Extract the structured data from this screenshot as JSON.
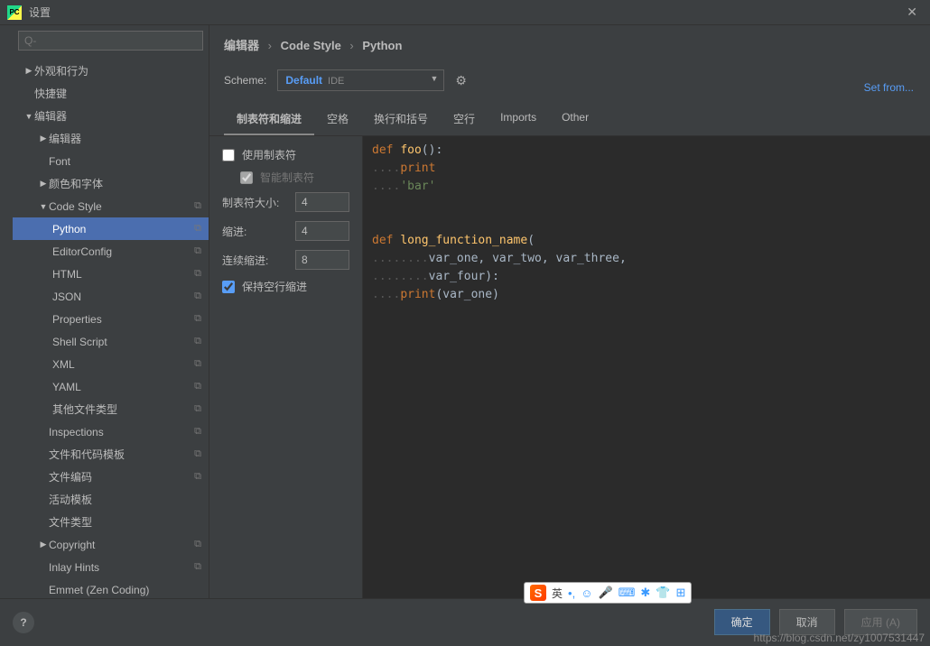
{
  "title": "设置",
  "search_placeholder": "Q-",
  "tree": {
    "appearance": "外观和行为",
    "keymap": "快捷键",
    "editor": "编辑器",
    "editor_sub": "编辑器",
    "font": "Font",
    "colors": "颜色和字体",
    "codestyle": "Code Style",
    "python": "Python",
    "editorconfig": "EditorConfig",
    "html": "HTML",
    "json": "JSON",
    "properties": "Properties",
    "shell": "Shell Script",
    "xml": "XML",
    "yaml": "YAML",
    "otherft": "其他文件类型",
    "inspections": "Inspections",
    "templates": "文件和代码模板",
    "encoding": "文件编码",
    "livetemplates": "活动模板",
    "filetypes": "文件类型",
    "copyright": "Copyright",
    "inlay": "Inlay Hints",
    "emmet": "Emmet (Zen Coding)"
  },
  "crumbs": {
    "a": "编辑器",
    "b": "Code Style",
    "c": "Python"
  },
  "scheme": {
    "label": "Scheme:",
    "value": "Default",
    "ide": "IDE"
  },
  "setfrom": "Set from...",
  "tabs": {
    "t1": "制表符和缩进",
    "t2": "空格",
    "t3": "换行和括号",
    "t4": "空行",
    "t5": "Imports",
    "t6": "Other"
  },
  "opts": {
    "usetab": "使用制表符",
    "smarttab": "智能制表符",
    "tabsize": "制表符大小:",
    "tabsize_v": "4",
    "indent": "缩进:",
    "indent_v": "4",
    "cont": "连续缩进:",
    "cont_v": "8",
    "keepblank": "保持空行缩进"
  },
  "code": {
    "l1_def": "def ",
    "l1_fn": "foo",
    "l1_rest": "():",
    "l2_dots": "....",
    "l2_kw": "print",
    "l3_dots": "....",
    "l3_str": "'bar'",
    "l5_def": "def ",
    "l5_fn": "long_function_name",
    "l5_rest": "(",
    "l6_dots": "........",
    "l6_p": "var_one, var_two, var_three,",
    "l7_dots": "........",
    "l7_p": "var_four):",
    "l8_dots": "....",
    "l8_kw": "print",
    "l8_rest": "(var_one)"
  },
  "buttons": {
    "ok": "确定",
    "cancel": "取消",
    "apply": "应用 (A)"
  },
  "watermark": "https://blog.csdn.net/zy1007531447",
  "sogou": {
    "zh": "英"
  }
}
